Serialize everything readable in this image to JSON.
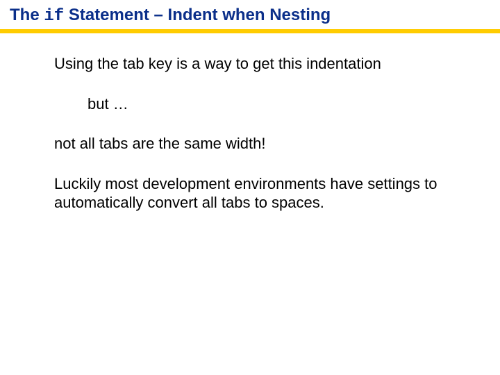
{
  "title": {
    "pre": "The ",
    "code": "if",
    "post": " Statement – Indent when Nesting"
  },
  "body": {
    "p1": "Using the tab key is a way to get this indentation",
    "p2": "but …",
    "p3": "not all tabs are the same width!",
    "p4": "Luckily most development environments have settings to automatically convert all tabs to spaces."
  }
}
